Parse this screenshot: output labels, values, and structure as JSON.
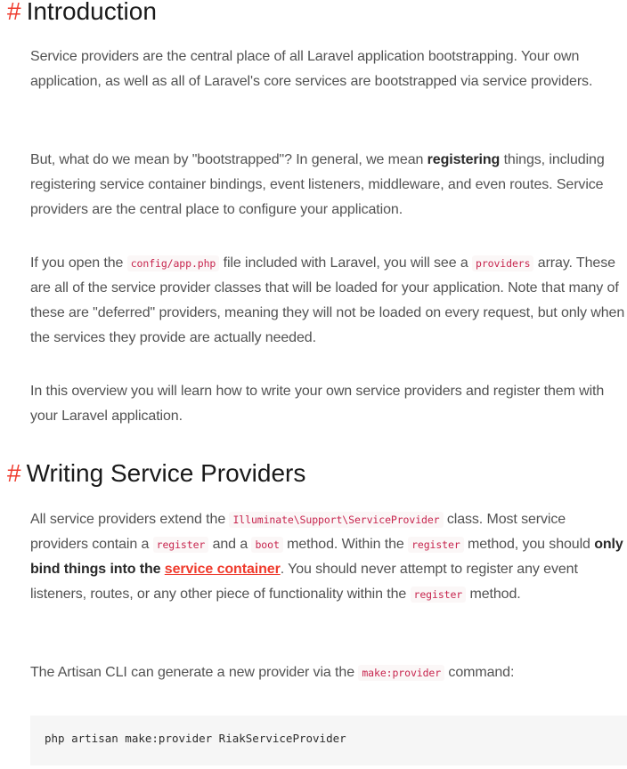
{
  "intro": {
    "hash": "#",
    "title": "Introduction",
    "p1": "Service providers are the central place of all Laravel application bootstrapping. Your own application, as well as all of Laravel's core services are bootstrapped via service providers.",
    "p2_a": "But, what do we mean by \"bootstrapped\"? In general, we mean ",
    "p2_strong": "registering",
    "p2_b": " things, including registering service container bindings, event listeners, middleware, and even routes. Service providers are the central place to configure your application.",
    "p3_a": "If you open the ",
    "p3_code1": "config/app.php",
    "p3_b": " file included with Laravel, you will see a ",
    "p3_code2": "providers",
    "p3_c": " array. These are all of the service provider classes that will be loaded for your application. Note that many of these are \"deferred\" providers, meaning they will not be loaded on every request, but only when the services they provide are actually needed.",
    "p4": "In this overview you will learn how to write your own service providers and register them with your Laravel application."
  },
  "writing": {
    "hash": "#",
    "title": "Writing Service Providers",
    "p1_a": "All service providers extend the ",
    "p1_code1": "Illuminate\\Support\\ServiceProvider",
    "p1_b": " class. Most service providers contain a ",
    "p1_code2": "register",
    "p1_c": " and a ",
    "p1_code3": "boot",
    "p1_d": " method. Within the ",
    "p1_code4": "register",
    "p1_e": " method, you should ",
    "p1_strong": "only bind things into the ",
    "p1_link": "service container",
    "p1_f": ". You should never attempt to register any event listeners, routes, or any other piece of functionality within the ",
    "p1_code5": "register",
    "p1_g": " method.",
    "p2_a": "The Artisan CLI can generate a new provider via the ",
    "p2_code": "make:provider",
    "p2_b": " command:",
    "command": "php artisan make:provider RiakServiceProvider"
  },
  "colors": {
    "accent": "#ef3b2d",
    "heading": "#1a1a1a",
    "body_text": "#525252",
    "inline_code": "#c7254e",
    "code_bg": "#f6f6f6"
  }
}
